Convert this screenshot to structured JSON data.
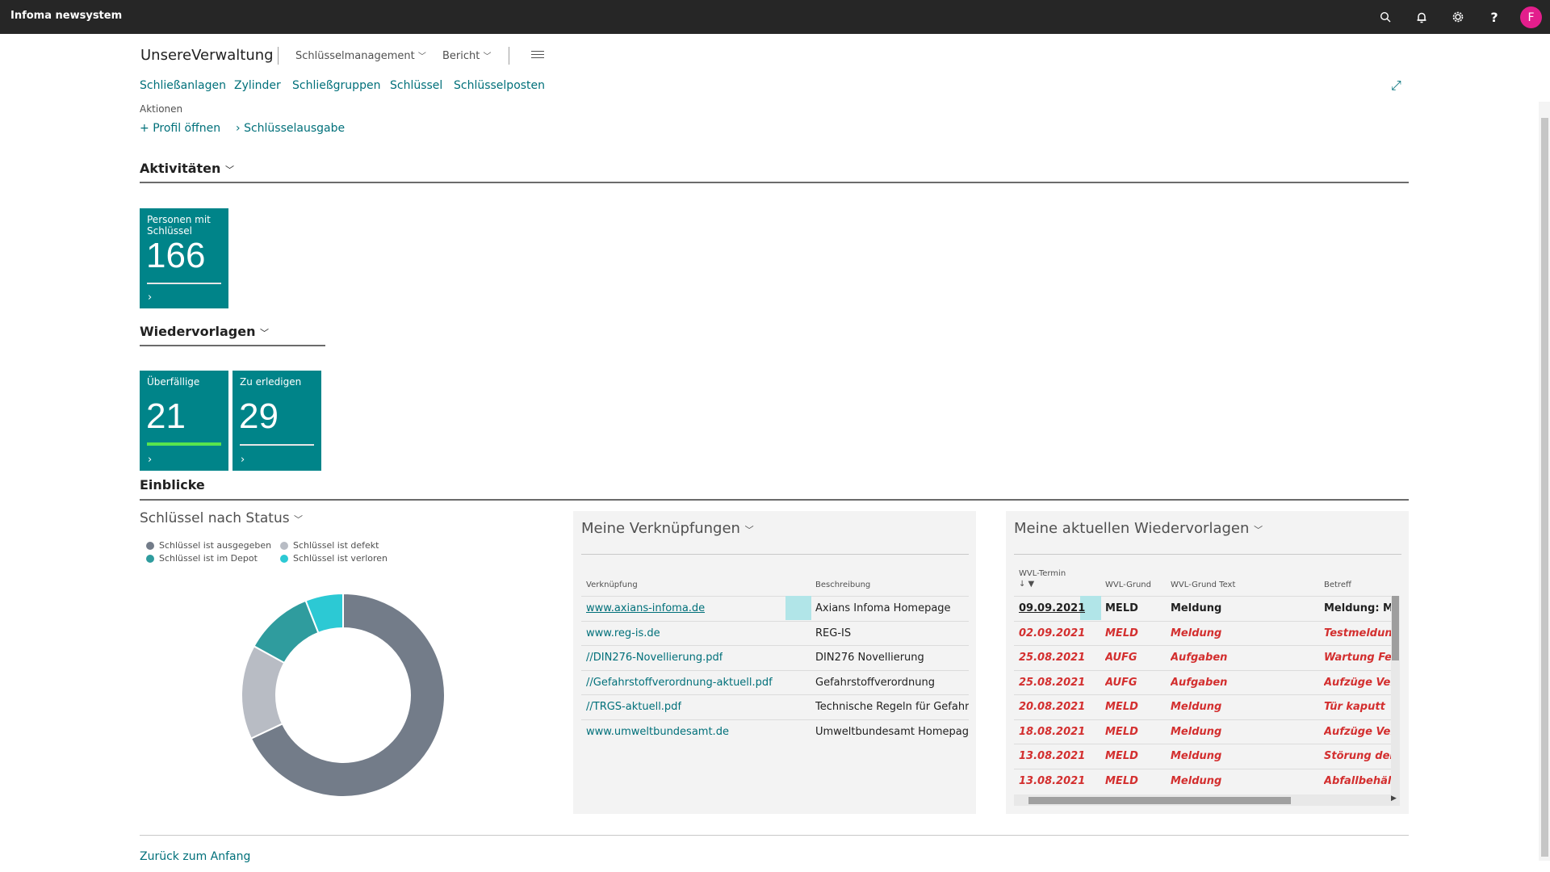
{
  "app": {
    "title": "Infoma newsystem",
    "user_initial": "F"
  },
  "header": {
    "company": "UnsereVerwaltung",
    "menus": [
      "Schlüsselmanagement",
      "Bericht"
    ]
  },
  "nav": [
    "Schließanlagen",
    "Zylinder",
    "Schließgruppen",
    "Schlüssel",
    "Schlüsselposten"
  ],
  "actions": {
    "label": "Aktionen",
    "items": [
      "Profil öffnen",
      "Schlüsselausgabe"
    ]
  },
  "aktivitaeten": {
    "title": "Aktivitäten",
    "tile": {
      "label": "Personen mit Schlüssel",
      "value": "166"
    }
  },
  "wiedervorlagen": {
    "title": "Wiedervorlagen",
    "tiles": [
      {
        "label": "Überfällige",
        "value": "21"
      },
      {
        "label": "Zu erledigen",
        "value": "29"
      }
    ]
  },
  "einblicke": {
    "title": "Einblicke"
  },
  "chart_data": {
    "type": "pie",
    "title": "Schlüssel nach Status",
    "categories": [
      "Schlüssel ist ausgegeben",
      "Schlüssel ist defekt",
      "Schlüssel ist im Depot",
      "Schlüssel ist verloren"
    ],
    "values": [
      68,
      15,
      11,
      6
    ],
    "colors": [
      "#737c89",
      "#b8bcc4",
      "#2f9c9e",
      "#2cc9d4"
    ],
    "legend_position": "top-left"
  },
  "links_panel": {
    "title": "Meine Verknüpfungen",
    "columns": [
      "Verknüpfung",
      "Beschreibung"
    ],
    "rows": [
      {
        "link": "www.axians-infoma.de",
        "desc": "Axians Infoma Homepage"
      },
      {
        "link": "www.reg-is.de",
        "desc": "REG-IS"
      },
      {
        "link": "//DIN276-Novellierung.pdf",
        "desc": "DIN276 Novellierung"
      },
      {
        "link": "//Gefahrstoffverordnung-aktuell.pdf",
        "desc": "Gefahrstoffverordnung"
      },
      {
        "link": "//TRGS-aktuell.pdf",
        "desc": "Technische Regeln für Gefahrsto..."
      },
      {
        "link": "www.umweltbundesamt.de",
        "desc": "Umweltbundesamt Homepage"
      }
    ]
  },
  "wvl_panel": {
    "title": "Meine aktuellen Wiedervorlagen",
    "columns": [
      "WVL-Termin",
      "WVL-Grund",
      "WVL-Grund Text",
      "Betreff"
    ],
    "rows": [
      {
        "date": "09.09.2021",
        "grund": "MELD",
        "text": "Meldung",
        "betreff": "Meldung: MLD",
        "overdue": false
      },
      {
        "date": "02.09.2021",
        "grund": "MELD",
        "text": "Meldung",
        "betreff": "Testmeldung V",
        "overdue": true
      },
      {
        "date": "25.08.2021",
        "grund": "AUFG",
        "text": "Aufgaben",
        "betreff": "Wartung Feue",
        "overdue": true
      },
      {
        "date": "25.08.2021",
        "grund": "AUFG",
        "text": "Aufgaben",
        "betreff": "Aufzüge Verw",
        "overdue": true
      },
      {
        "date": "20.08.2021",
        "grund": "MELD",
        "text": "Meldung",
        "betreff": "Tür kaputt",
        "overdue": true
      },
      {
        "date": "18.08.2021",
        "grund": "MELD",
        "text": "Meldung",
        "betreff": "Aufzüge Verw",
        "overdue": true
      },
      {
        "date": "13.08.2021",
        "grund": "MELD",
        "text": "Meldung",
        "betreff": "Störung der H",
        "overdue": true
      },
      {
        "date": "13.08.2021",
        "grund": "MELD",
        "text": "Meldung",
        "betreff": "Abfallbehälter",
        "overdue": true
      }
    ]
  },
  "footer": {
    "back_to_top": "Zurück zum Anfang"
  }
}
